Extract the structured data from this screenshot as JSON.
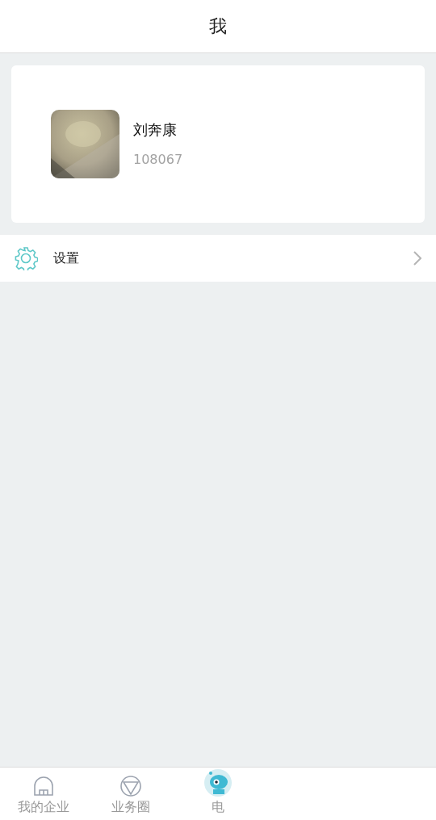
{
  "header": {
    "title": "我"
  },
  "profile": {
    "name": "刘奔康",
    "id": "108067"
  },
  "menu": [
    {
      "kind": "settings",
      "label": "设置"
    }
  ],
  "tab_bar": [
    {
      "kind": "building",
      "label": "我的企业"
    },
    {
      "kind": "circle",
      "label": "业务圈"
    },
    {
      "kind": "robot",
      "label": "电"
    }
  ]
}
